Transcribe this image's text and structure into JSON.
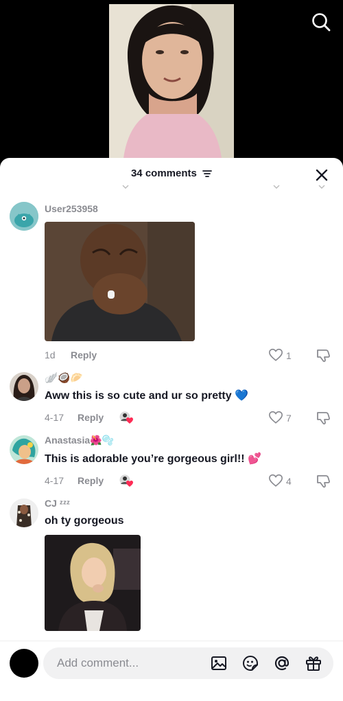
{
  "header": {
    "comments_count": "34 comments"
  },
  "comments": [
    {
      "username": "User253958",
      "date": "1d",
      "reply_label": "Reply",
      "likes": "1",
      "media": "reaction-gif-man-crying"
    },
    {
      "username": "🪽🥥🥟",
      "text": "Aww this is so cute and ur so pretty 💙",
      "date": "4-17",
      "reply_label": "Reply",
      "likes": "7"
    },
    {
      "username": "Anastasia🌺🫧",
      "text": "This is adorable you’re gorgeous girl!! 💕",
      "date": "4-17",
      "reply_label": "Reply",
      "likes": "4"
    },
    {
      "username": "CJ ᶻᶻᶻ",
      "text": "oh ty gorgeous",
      "media": "reaction-gif-woman-laughing"
    }
  ],
  "composer": {
    "placeholder": "Add comment..."
  },
  "icons": {
    "search": "search-icon",
    "close": "close-icon",
    "filter": "filter-icon",
    "heart": "heart-outline-icon",
    "dislike": "thumbs-down-icon",
    "image": "image-icon",
    "emoji": "emoji-icon",
    "mention": "at-icon",
    "gift": "gift-icon"
  },
  "colors": {
    "text_primary": "#161823",
    "text_secondary": "#8a8b91",
    "input_bg": "#f1f1f2"
  }
}
